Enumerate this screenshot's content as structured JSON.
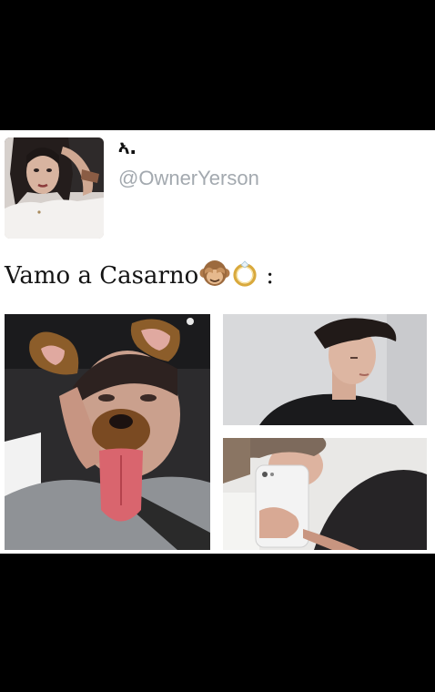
{
  "tweet": {
    "display_name": "ኣ.",
    "handle": "@OwnerYerson",
    "text": "Vamo a Casarno",
    "text_suffix": ":",
    "emojis": [
      "see-no-evil-monkey-icon",
      "ring-icon"
    ]
  },
  "colors": {
    "background": "#000000",
    "card": "#ffffff",
    "handle_gray": "#a3a9af",
    "text": "#141414"
  },
  "photos": [
    {
      "name": "photo-main",
      "subject": "selfie with dog filter"
    },
    {
      "name": "photo-top-right",
      "subject": "portrait looking down"
    },
    {
      "name": "photo-bottom-right",
      "subject": "mirror selfie with phone"
    }
  ]
}
